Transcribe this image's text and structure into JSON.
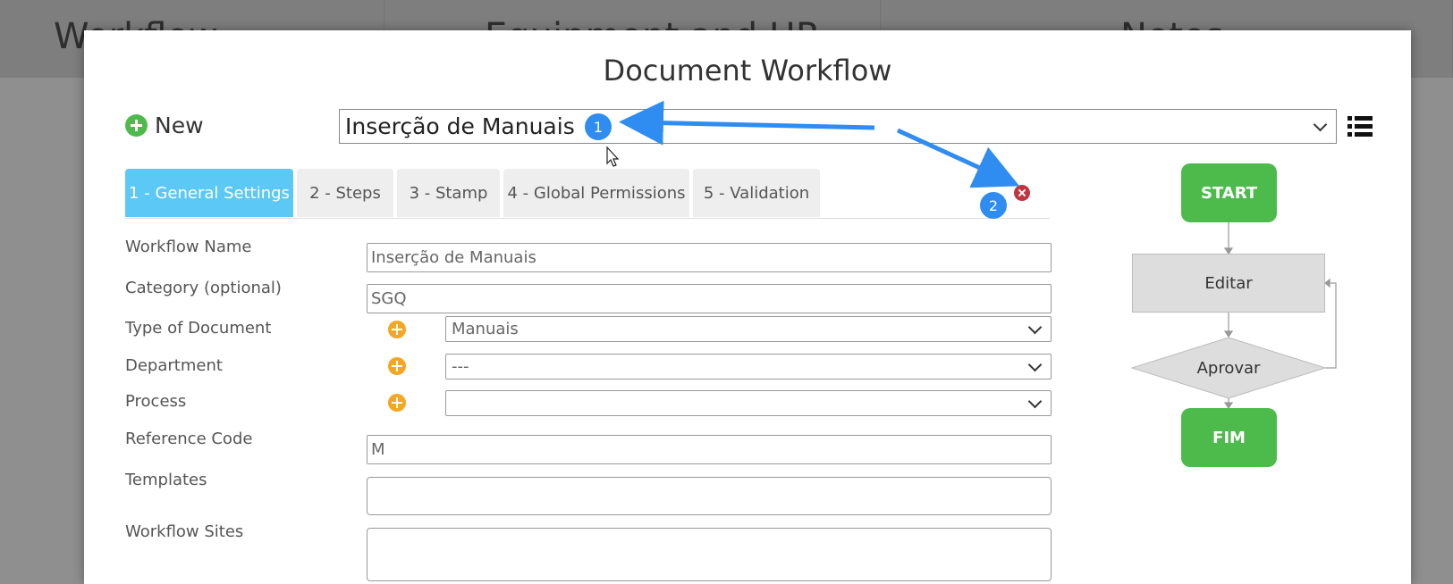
{
  "background": {
    "columns": [
      "Workflow",
      "Equipment and HR",
      "Notes"
    ]
  },
  "modal": {
    "title": "Document Workflow",
    "new_label": "New",
    "workflow_selected": "Inserção de Manuais"
  },
  "tabs": [
    {
      "label": "1 - General Settings",
      "active": true
    },
    {
      "label": "2 - Steps",
      "active": false
    },
    {
      "label": "3 - Stamp",
      "active": false
    },
    {
      "label": "4 - Global Permissions",
      "active": false
    },
    {
      "label": "5 - Validation",
      "active": false
    }
  ],
  "form": {
    "workflow_name_label": "Workflow Name",
    "workflow_name_value": "Inserção de Manuais",
    "category_label": "Category (optional)",
    "category_value": "SGQ",
    "type_label": "Type of Document",
    "type_value": "Manuais",
    "department_label": "Department",
    "department_value": "---",
    "process_label": "Process",
    "process_value": "",
    "reference_label": "Reference Code",
    "reference_value": "M",
    "templates_label": "Templates",
    "sites_label": "Workflow Sites"
  },
  "flow": {
    "start": "START",
    "step": "Editar",
    "decision": "Aprovar",
    "end": "FIM"
  },
  "annotations": {
    "badge1": "1",
    "badge2": "2"
  },
  "colors": {
    "active_tab": "#5bc8f5",
    "flow_green": "#4cbb4c",
    "annotation_blue": "#2f8cf0",
    "close_red": "#c0363e",
    "add_orange": "#f5a623"
  }
}
